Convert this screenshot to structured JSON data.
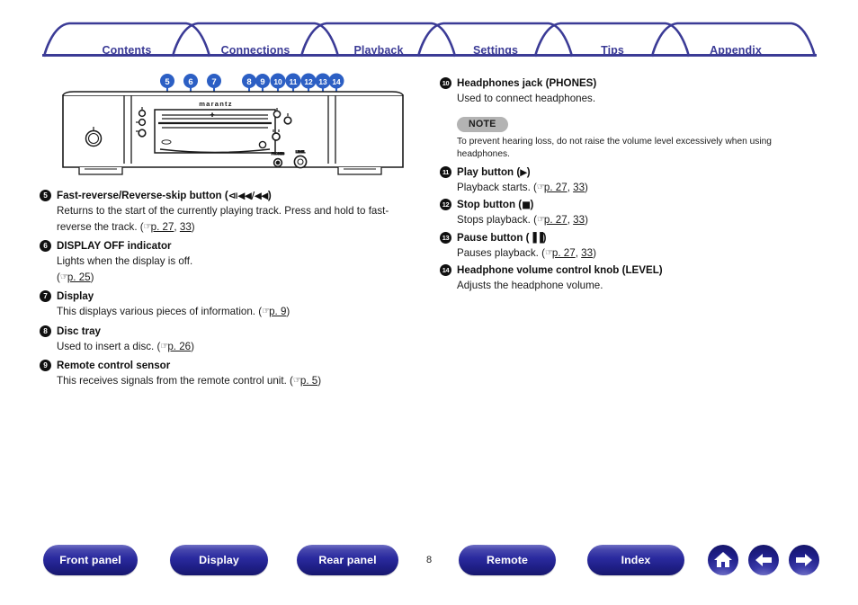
{
  "tabs": [
    {
      "label": "Contents"
    },
    {
      "label": "Connections"
    },
    {
      "label": "Playback"
    },
    {
      "label": "Settings"
    },
    {
      "label": "Tips"
    },
    {
      "label": "Appendix"
    }
  ],
  "diagram": {
    "brand": "marantz",
    "callouts": [
      "5",
      "6",
      "7",
      "8",
      "9",
      "10",
      "11",
      "12",
      "13",
      "14"
    ]
  },
  "left_column": [
    {
      "num": "5",
      "title": "Fast-reverse/Reverse-skip button (",
      "title_glyph": "⧏◀◀/◀◀",
      "title_tail": ")",
      "line1": "Returns to the start of the currently playing track. Press and hold to fast-",
      "line2_pre": "reverse the track.  (",
      "hand": "☞",
      "page_a": "p. 27",
      "sep": ",  ",
      "page_b": "33",
      "line2_post": ")"
    },
    {
      "num": "6",
      "title": "DISPLAY OFF indicator",
      "line1": "Lights when the display is off.",
      "line2_pre": " (",
      "hand": "☞",
      "page_a": "p. 25",
      "line2_post": ")"
    },
    {
      "num": "7",
      "title": "Display",
      "line1_pre": "This displays various pieces of information.  (",
      "hand": "☞",
      "page_a": "p. 9",
      "line1_post": ")"
    },
    {
      "num": "8",
      "title": "Disc tray",
      "line1_pre": "Used to insert a disc.  (",
      "hand": "☞",
      "page_a": "p. 26",
      "line1_post": ")"
    },
    {
      "num": "9",
      "title": "Remote control sensor",
      "line1_pre": "This receives signals from the remote control unit.  (",
      "hand": "☞",
      "page_a": "p. 5",
      "line1_post": ")"
    }
  ],
  "right_column": {
    "headphones": {
      "num": "10",
      "title": "Headphones jack (PHONES)",
      "body": "Used to connect headphones.",
      "note_badge": "NOTE",
      "note_text": "To prevent hearing loss, do not raise the volume level excessively when using headphones."
    },
    "items": [
      {
        "num": "11",
        "title": "Play button (",
        "title_glyph": "▶",
        "title_tail": ")",
        "body_pre": "Playback starts.  (",
        "hand": "☞",
        "page_a": "p. 27",
        "sep": ",  ",
        "page_b": "33",
        "body_post": ")"
      },
      {
        "num": "12",
        "title": "Stop button (",
        "title_glyph": "■",
        "title_tail": ")",
        "body_pre": "Stops playback.  (",
        "hand": "☞",
        "page_a": "p. 27",
        "sep": ",  ",
        "page_b": "33",
        "body_post": ")"
      },
      {
        "num": "13",
        "title": "Pause button (",
        "title_glyph": "▐▐",
        "title_tail": ")",
        "body_pre": "Pauses playback.  (",
        "hand": "☞",
        "page_a": "p. 27",
        "sep": ",  ",
        "page_b": "33",
        "body_post": ")"
      },
      {
        "num": "14",
        "title": "Headphone volume control knob (LEVEL)",
        "body_pre": "Adjusts the headphone volume."
      }
    ]
  },
  "footer": {
    "buttons": [
      {
        "label": "Front panel"
      },
      {
        "label": "Display"
      },
      {
        "label": "Rear panel"
      },
      {
        "label": "Remote"
      },
      {
        "label": "Index"
      }
    ],
    "page_number": "8",
    "icons": [
      "home-icon",
      "back-arrow-icon",
      "forward-arrow-icon"
    ]
  },
  "colors": {
    "tab_navy": "#3b3b96",
    "button_blue": "#2b2ba0",
    "note_gray": "#b3b3b3",
    "leader_blue": "#2c5fc4"
  }
}
